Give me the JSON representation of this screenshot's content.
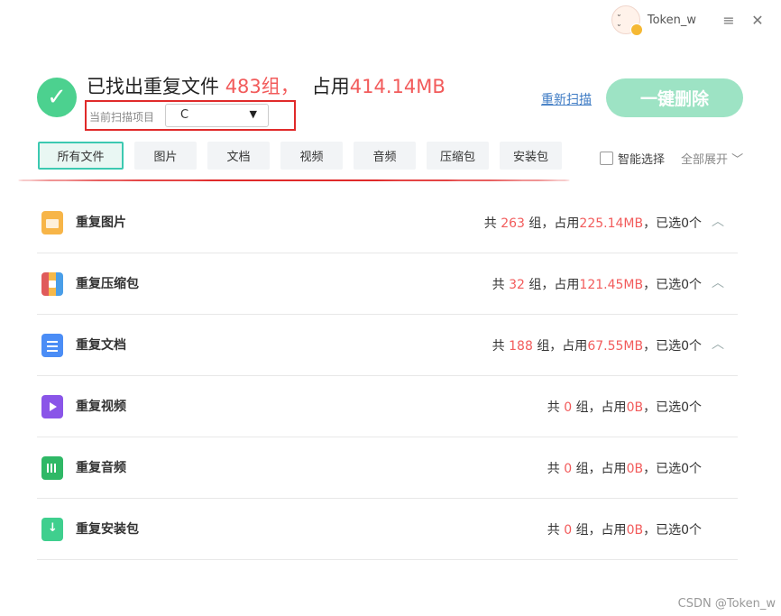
{
  "topbar": {
    "username": "Token_w",
    "menu_icon": "≡",
    "close_icon": "✕"
  },
  "header": {
    "title_prefix": "已找出重复文件",
    "group_count": "483组，",
    "usage_prefix": "占用",
    "usage_value": "414.14MB",
    "scan_label": "当前扫描项目",
    "scan_value": "C",
    "rescan_label": "重新扫描",
    "delete_label": "一键删除"
  },
  "tabs": [
    {
      "label": "所有文件",
      "active": true
    },
    {
      "label": "图片"
    },
    {
      "label": "文档"
    },
    {
      "label": "视频"
    },
    {
      "label": "音频"
    },
    {
      "label": "压缩包"
    },
    {
      "label": "安装包"
    }
  ],
  "options": {
    "smart_select": "智能选择",
    "expand_all": "全部展开"
  },
  "categories": [
    {
      "name": "重复图片",
      "icon": "image-file-icon",
      "count": "263",
      "size": "225.14MB",
      "selected": "已选0个",
      "expandable": true
    },
    {
      "name": "重复压缩包",
      "icon": "archive-file-icon",
      "count": "32",
      "size": "121.45MB",
      "selected": "已选0个",
      "expandable": true
    },
    {
      "name": "重复文档",
      "icon": "document-file-icon",
      "count": "188",
      "size": "67.55MB",
      "selected": "已选0个",
      "expandable": true
    },
    {
      "name": "重复视频",
      "icon": "video-file-icon",
      "count": "0",
      "size": "0B",
      "selected": "已选0个",
      "expandable": false
    },
    {
      "name": "重复音频",
      "icon": "audio-file-icon",
      "count": "0",
      "size": "0B",
      "selected": "已选0个",
      "expandable": false
    },
    {
      "name": "重复安装包",
      "icon": "installer-file-icon",
      "count": "0",
      "size": "0B",
      "selected": "已选0个",
      "expandable": false
    }
  ],
  "stats_text": {
    "prefix": "共",
    "mid": "组，占用",
    "sep": "，"
  },
  "watermark": "CSDN @Token_w",
  "colors": {
    "accent_red": "#f25b5b",
    "accent_green": "#4cd18f",
    "link_blue": "#3e7bc4",
    "annotation_red": "#e02a2a"
  }
}
